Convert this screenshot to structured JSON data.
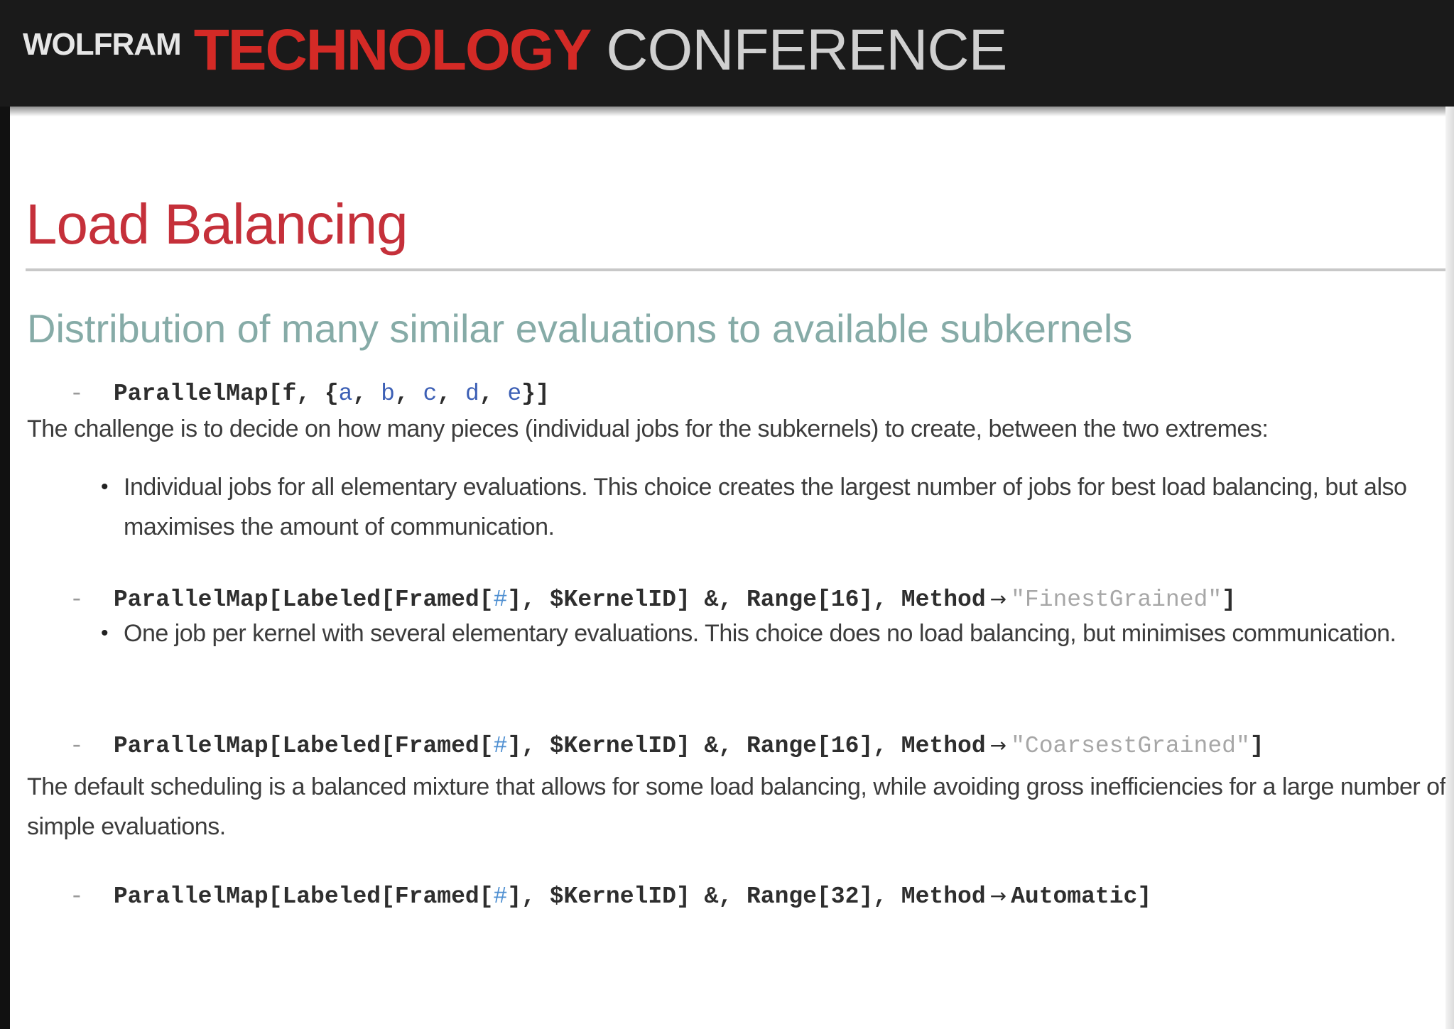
{
  "banner": {
    "brand_small": "WOLFRAM",
    "brand_red": "TECHNOLOGY",
    "brand_grey": "CONFERENCE"
  },
  "slide": {
    "title": "Load Balancing",
    "subtitle": "Distribution of many similar evaluations to available subkernels",
    "code1": {
      "head": "ParallelMap[f, {",
      "a": "a",
      "b": "b",
      "c": "c",
      "d": "d",
      "e": "e",
      "tail": "}]"
    },
    "para1": "The challenge is to decide on how many pieces (individual jobs for the subkernels) to create, between the two extremes:",
    "bullet1": "Individual jobs for all elementary evaluations. This choice creates the largest number of jobs for best load balancing, but also maximises the amount of communication.",
    "code2": {
      "head": "ParallelMap[Labeled[Framed[",
      "slot": "#",
      "mid": "], $KernelID] &, Range[16], Method",
      "arrow": "→",
      "str": "\"FinestGrained\"",
      "tail": "]"
    },
    "bullet2": "One job per kernel with several elementary evaluations. This choice does no load balancing, but minimises communication.",
    "code3": {
      "head": "ParallelMap[Labeled[Framed[",
      "slot": "#",
      "mid": "], $KernelID] &, Range[16], Method",
      "arrow": "→",
      "str": "\"CoarsestGrained\"",
      "tail": "]"
    },
    "para2": "The default scheduling is a balanced mixture that allows for some load balancing, while avoiding gross inefficiencies for a large number of simple evaluations.",
    "code4": {
      "head": "ParallelMap[Labeled[Framed[",
      "slot": "#",
      "mid": "], $KernelID] &, Range[32], Method",
      "arrow": "→",
      "tail": "Automatic]"
    },
    "bullet_glyph": "•",
    "dash_glyph": "-"
  }
}
